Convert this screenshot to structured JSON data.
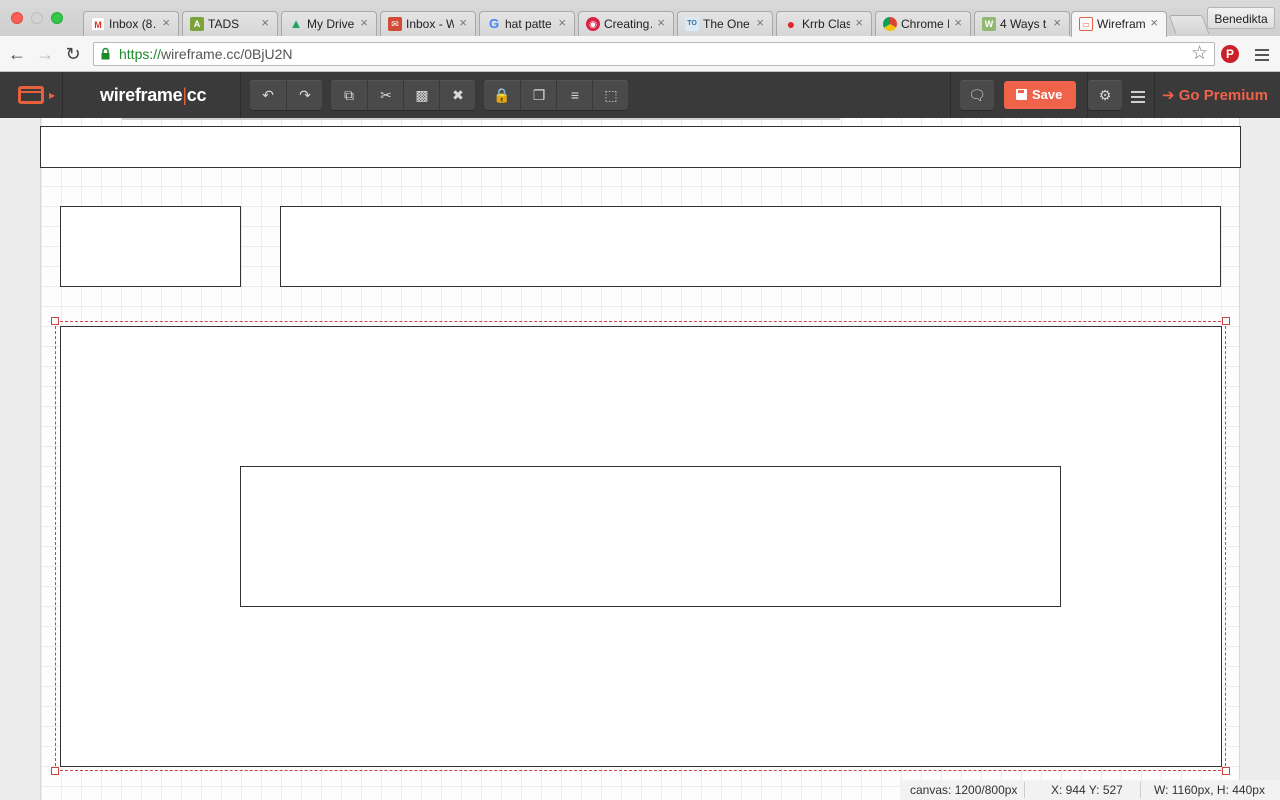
{
  "browser": {
    "tabs": [
      {
        "label": "Inbox (8…",
        "favicon": "gmail-icon",
        "color": "#d93025",
        "glyph": "M"
      },
      {
        "label": "TADS",
        "favicon": "tads-icon",
        "color": "#7ca33a",
        "glyph": "A"
      },
      {
        "label": "My Drive",
        "favicon": "drive-icon",
        "color": "#1fa463",
        "glyph": "▲"
      },
      {
        "label": "Inbox - W…",
        "favicon": "inbox-icon",
        "color": "#d04b35",
        "glyph": "✉"
      },
      {
        "label": "hat patte…",
        "favicon": "google-icon",
        "color": "#4285f4",
        "glyph": "G"
      },
      {
        "label": "Creating…",
        "favicon": "creating-icon",
        "color": "#d9244a",
        "glyph": "◉"
      },
      {
        "label": "The One…",
        "favicon": "theone-icon",
        "color": "#6aa0c8",
        "glyph": "T"
      },
      {
        "label": "Krrb Clas…",
        "favicon": "krrb-icon",
        "color": "#e0262d",
        "glyph": "●"
      },
      {
        "label": "Chrome I…",
        "favicon": "chrome-icon",
        "color": "#e2b714",
        "glyph": "◎"
      },
      {
        "label": "4 Ways t…",
        "favicon": "wikihow-icon",
        "color": "#93b874",
        "glyph": "W"
      },
      {
        "label": "Wirefram…",
        "favicon": "wireframe-icon",
        "color": "#e8613c",
        "glyph": "▭"
      }
    ],
    "profile_name": "Benedikta",
    "url_scheme": "https://",
    "url_rest": "wireframe.cc/0BjU2N",
    "pinterest_glyph": "P"
  },
  "app": {
    "brand_left": "wireframe",
    "brand_bar": "|",
    "brand_right": "cc",
    "save_label": "Save",
    "premium_label": "Go Premium",
    "premium_arrow": "➔",
    "accent_color": "#f0624a"
  },
  "status": {
    "canvas": "canvas: 1200/800px",
    "cursor": "X: 944 Y: 527",
    "size": "W: 1160px, H: 440px"
  }
}
